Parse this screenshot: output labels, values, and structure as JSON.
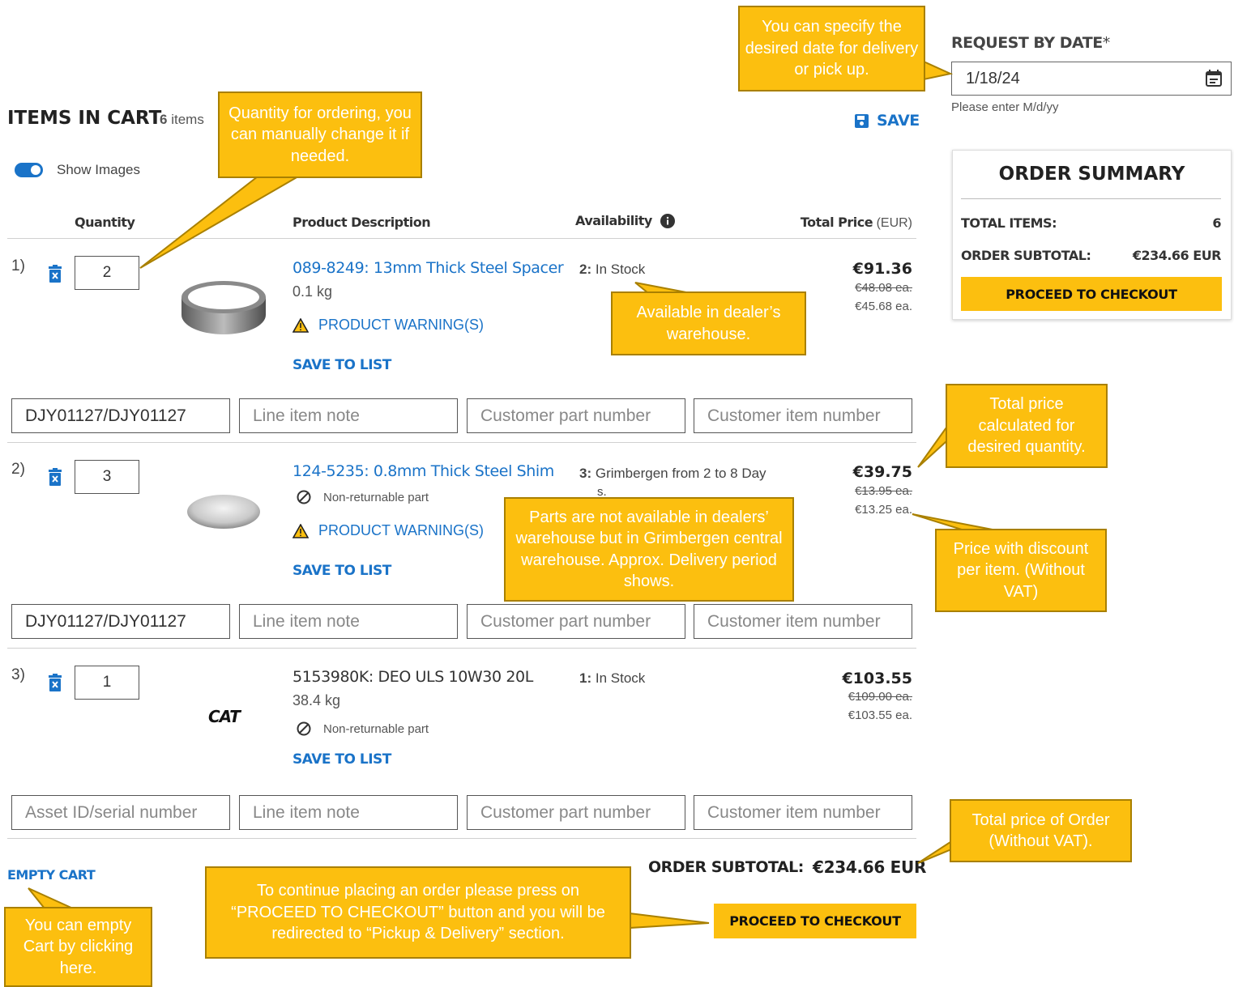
{
  "header": {
    "items_in_cart_title": "ITEMS IN CART",
    "items_count": "6",
    "items_word": "items",
    "save_label": "SAVE",
    "show_images_label": "Show Images"
  },
  "request_date": {
    "label": "REQUEST BY DATE",
    "required_mark": "*",
    "value": "1/18/24",
    "hint": "Please enter M/d/yy"
  },
  "columns": {
    "quantity": "Quantity",
    "description": "Product Description",
    "availability": "Availability",
    "total_price": "Total Price",
    "currency": "(EUR)"
  },
  "items": [
    {
      "index": "1)",
      "qty": "2",
      "title": "089-8249: 13mm Thick Steel Spacer",
      "weight": "0.1 kg",
      "warning": "PRODUCT WARNING(S)",
      "save_to_list": "SAVE TO LIST",
      "avail_count": "2:",
      "avail_text": "In Stock",
      "total": "€91.36",
      "list_price": "€48.08 ea.",
      "net_price": "€45.68 ea.",
      "fields": [
        "DJY01127/DJY01127",
        "Line item note",
        "Customer part number",
        "Customer item number"
      ]
    },
    {
      "index": "2)",
      "qty": "3",
      "title": "124-5235: 0.8mm Thick Steel Shim",
      "nonreturn": "Non-returnable part",
      "warning": "PRODUCT WARNING(S)",
      "save_to_list": "SAVE TO LIST",
      "avail_count": "3:",
      "avail_text": "Grimbergen from 2 to 8 Day",
      "avail_text2": "s.",
      "total": "€39.75",
      "list_price": "€13.95 ea.",
      "net_price": "€13.25 ea.",
      "fields": [
        "DJY01127/DJY01127",
        "Line item note",
        "Customer part number",
        "Customer item number"
      ]
    },
    {
      "index": "3)",
      "qty": "1",
      "title": "5153980K: DEO ULS 10W30 20L",
      "weight": "38.4 kg",
      "nonreturn": "Non-returnable part",
      "save_to_list": "SAVE TO LIST",
      "logo": "CAT",
      "avail_count": "1:",
      "avail_text": "In Stock",
      "total": "€103.55",
      "list_price": "€109.00 ea.",
      "net_price": "€103.55 ea.",
      "fields": [
        "Asset ID/serial number",
        "Line item note",
        "Customer part number",
        "Customer item number"
      ]
    }
  ],
  "footer": {
    "empty_cart": "EMPTY CART",
    "subtotal_label": "ORDER SUBTOTAL:",
    "subtotal_value": "€234.66 EUR",
    "checkout": "PROCEED TO CHECKOUT"
  },
  "summary": {
    "title": "ORDER SUMMARY",
    "total_items_label": "TOTAL ITEMS:",
    "total_items_value": "6",
    "subtotal_label": "ORDER SUBTOTAL:",
    "subtotal_value": "€234.66 EUR",
    "checkout": "PROCEED TO CHECKOUT"
  },
  "callouts": {
    "date": "You can specify the desired date for delivery or pick up.",
    "quantity": "Quantity for ordering, you can manually change it if needed.",
    "in_stock": "Available in dealer’s warehouse.",
    "total_price": "Total price calculated for desired quantity.",
    "central": "Parts are not available in dealers’ warehouse but in Grimbergen central warehouse. Approx. Delivery period shows.",
    "discount": "Price with discount per item. (Without VAT)",
    "order_total": "Total price of Order (Without VAT).",
    "proceed": "To continue placing an order please press on “PROCEED TO CHECKOUT” button and you will be redirected to “Pickup & Delivery” section.",
    "empty": "You can empty Cart by clicking here."
  },
  "colors": {
    "link": "#1a73c8",
    "callout": "#fcbf0f",
    "button": "#fcbf0f"
  }
}
